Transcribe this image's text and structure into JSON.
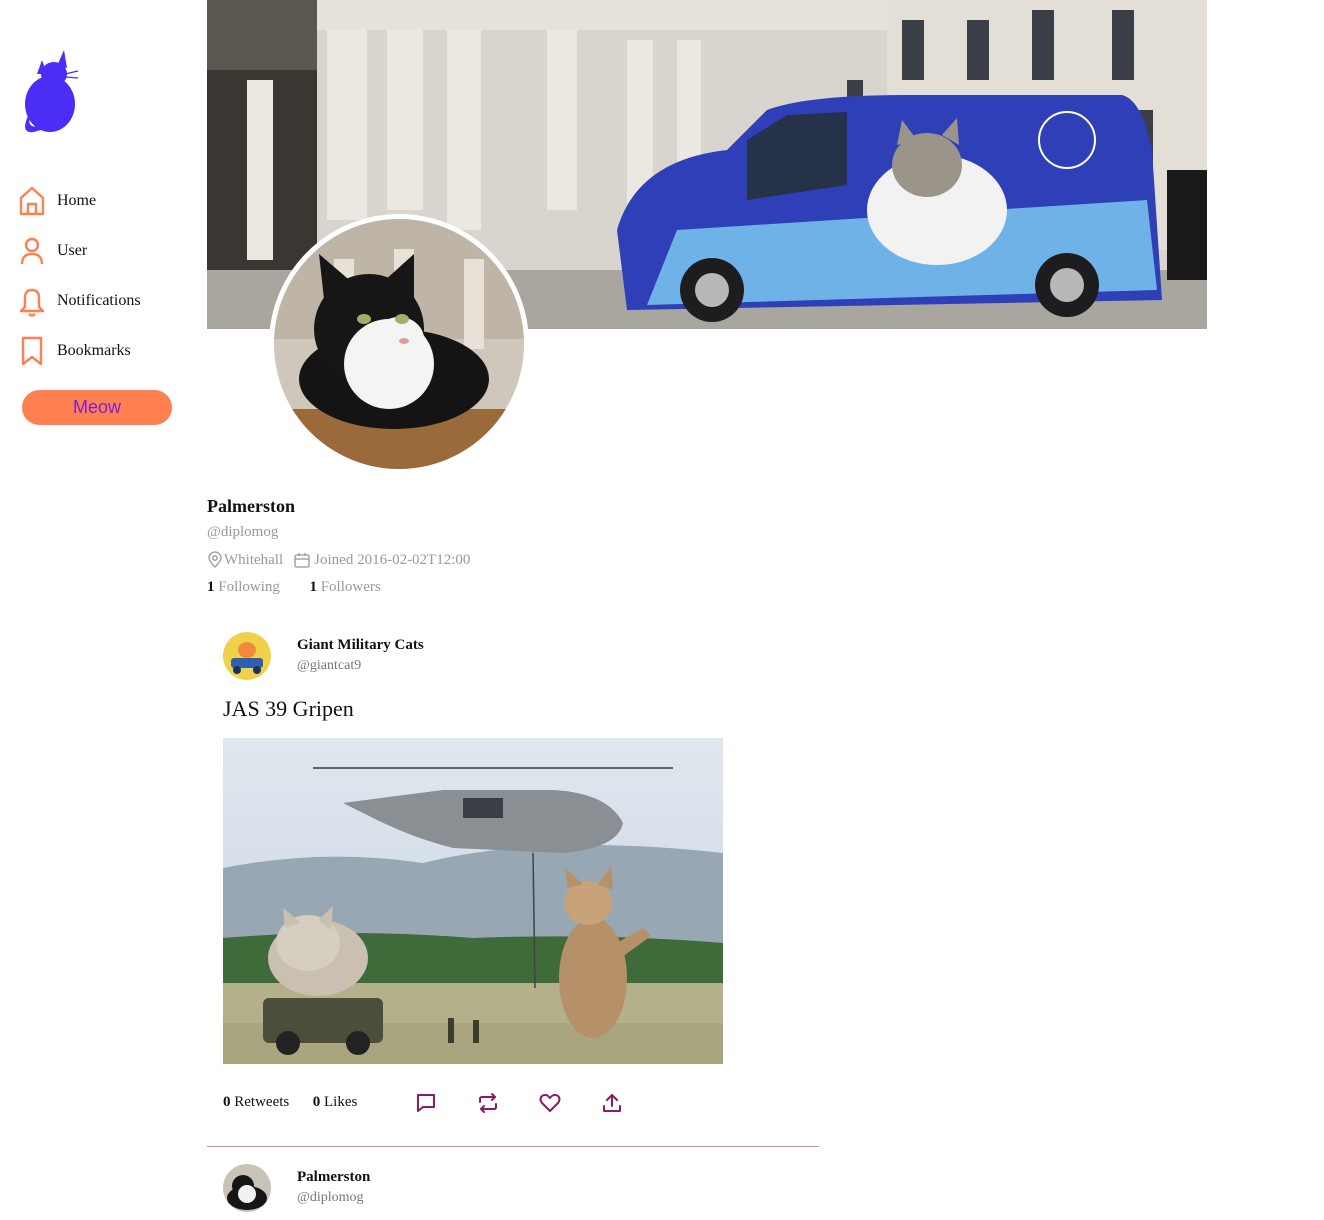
{
  "colors": {
    "accent": "#ff7f50",
    "logo": "#4b2ef5",
    "meow_text": "#7b1fd8",
    "action_icon": "#8a1a6a",
    "muted": "#999999"
  },
  "sidebar": {
    "logo_icon": "cat-logo-icon",
    "items": [
      {
        "label": "Home",
        "icon": "home-icon"
      },
      {
        "label": "User",
        "icon": "user-icon"
      },
      {
        "label": "Notifications",
        "icon": "bell-icon"
      },
      {
        "label": "Bookmarks",
        "icon": "bookmark-icon"
      }
    ],
    "meow_button": "Meow"
  },
  "profile": {
    "display_name": "Palmerston",
    "handle": "@diplomog",
    "location": "Whitehall",
    "joined": "Joined 2016-02-02T12:00",
    "following_count": "1",
    "following_label": "Following",
    "followers_count": "1",
    "followers_label": "Followers"
  },
  "tweets": [
    {
      "author": "Giant Military Cats",
      "handle": "@giantcat9",
      "text": "JAS 39 Gripen",
      "retweets_count": "0",
      "retweets_label": "Retweets",
      "likes_count": "0",
      "likes_label": "Likes",
      "actions": [
        "reply-icon",
        "retweet-icon",
        "like-icon",
        "share-icon"
      ]
    },
    {
      "author": "Palmerston",
      "handle": "@diplomog"
    }
  ]
}
